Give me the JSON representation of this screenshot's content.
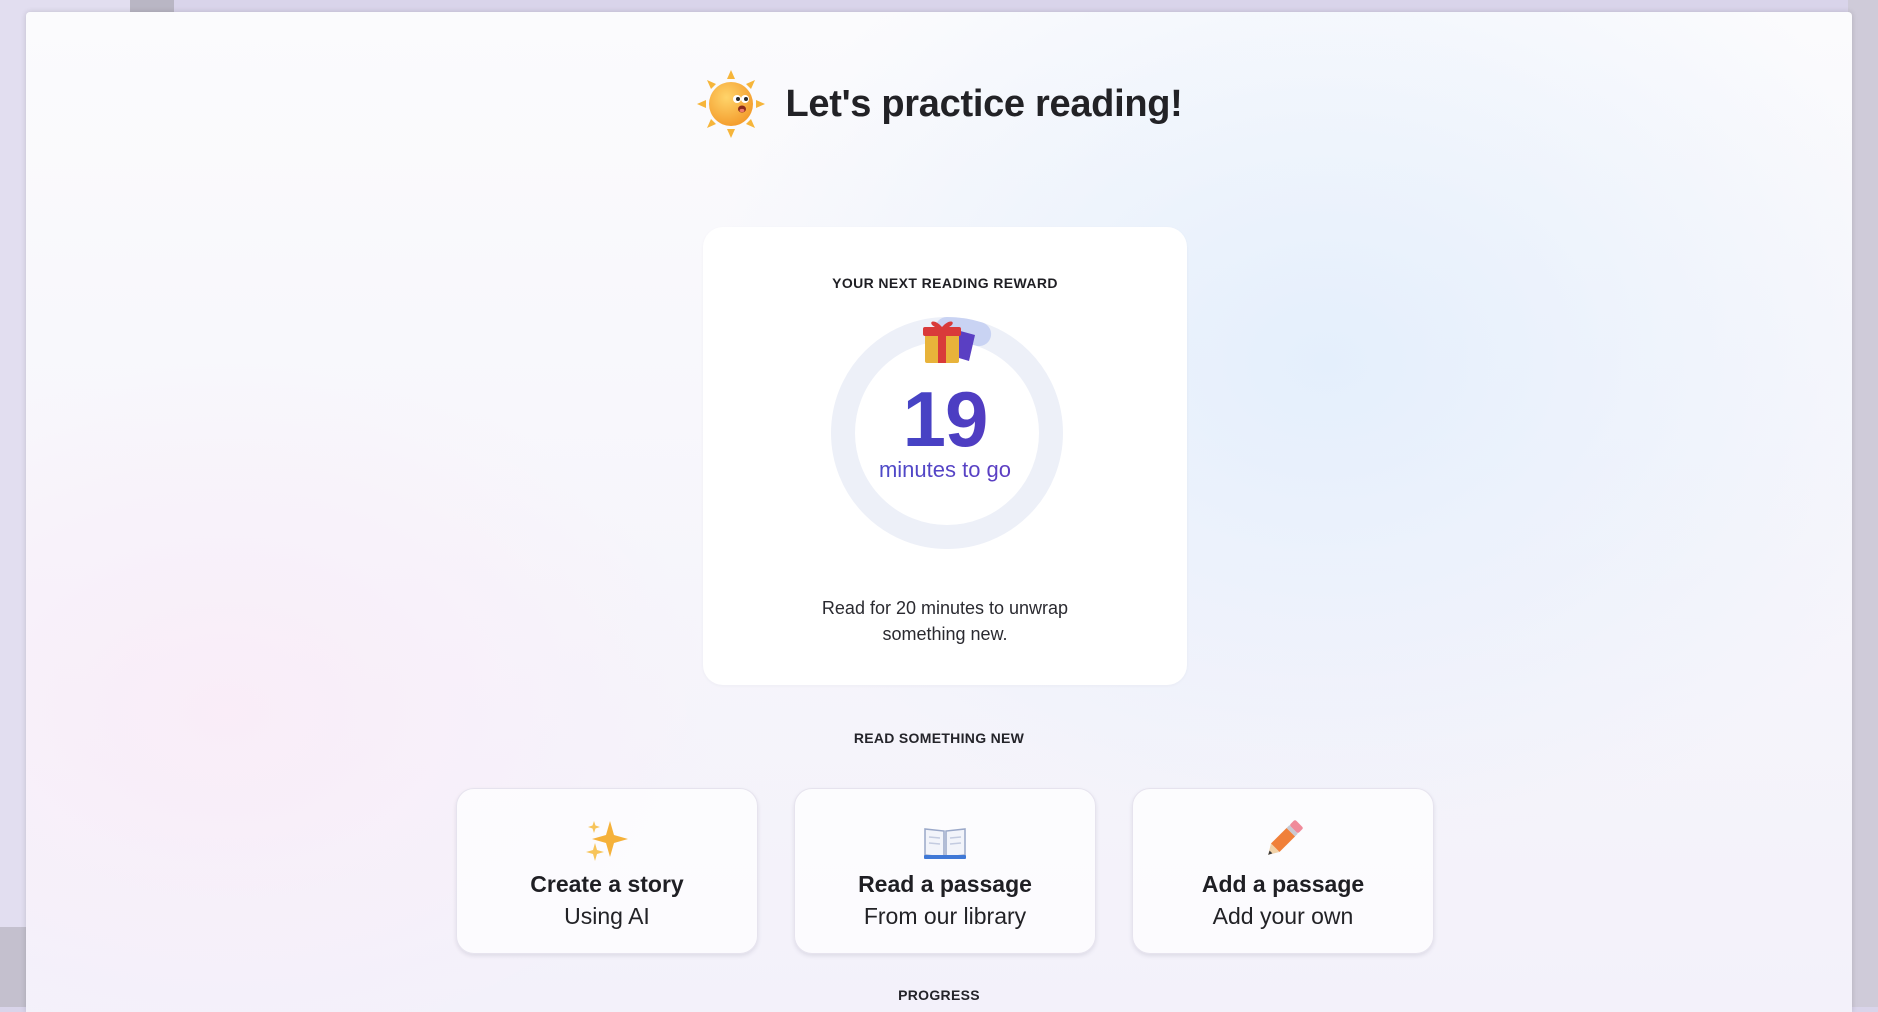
{
  "header": {
    "title": "Let's practice reading!",
    "icon": "sun-mascot-icon"
  },
  "reward": {
    "label": "YOUR NEXT READING REWARD",
    "icon": "gift-icon",
    "count": "19",
    "unit": "minutes to go",
    "progress_fraction": 0.05,
    "description": "Read for 20 minutes to unwrap something new."
  },
  "read_new": {
    "label": "READ SOMETHING NEW",
    "options": [
      {
        "icon": "sparkles-icon",
        "title": "Create a story",
        "subtitle": "Using AI"
      },
      {
        "icon": "open-book-icon",
        "title": "Read a passage",
        "subtitle": "From our library"
      },
      {
        "icon": "pencil-icon",
        "title": "Add a passage",
        "subtitle": "Add your own"
      }
    ]
  },
  "progress": {
    "label": "PROGRESS"
  },
  "colors": {
    "count_gradient_start": "#2f5fd0",
    "count_gradient_end": "#7a2fb8",
    "ring_track": "#edf0f8"
  }
}
